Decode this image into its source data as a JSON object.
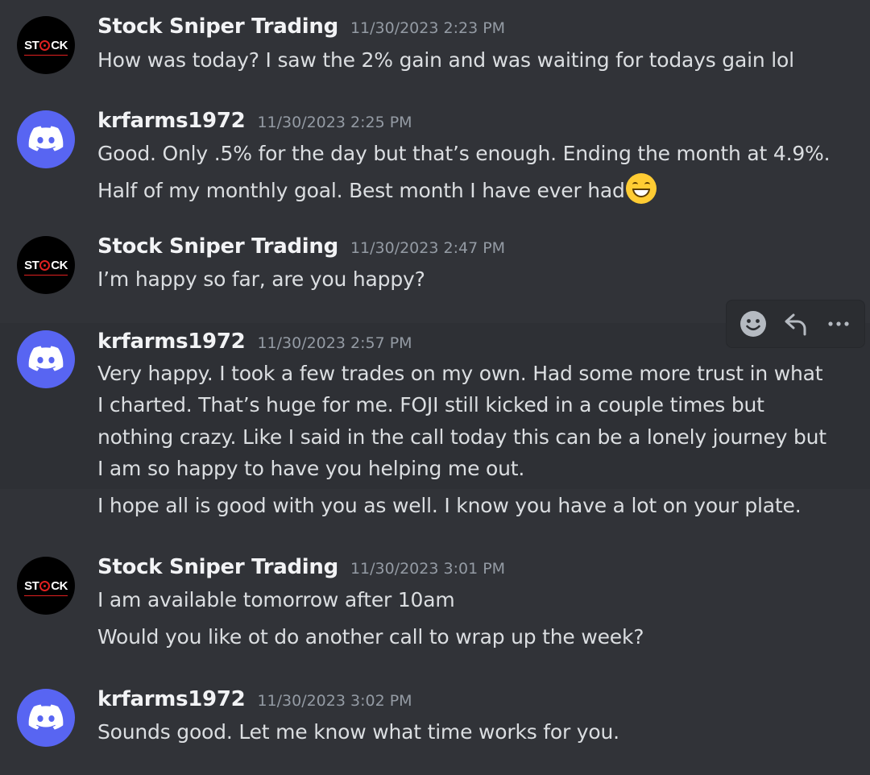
{
  "messages": [
    {
      "author": "Stock Sniper Trading",
      "timestamp": "11/30/2023 2:23 PM",
      "avatar_text": "ST  CK",
      "lines": [
        "How was today? I saw the 2% gain and was waiting for todays gain lol"
      ]
    },
    {
      "author": "krfarms1972",
      "timestamp": "11/30/2023 2:25 PM",
      "lines": [
        "Good. Only .5% for the day but that’s enough. Ending the month at 4.9%.",
        "Half of my monthly goal. Best month I have ever had"
      ],
      "emoji": "grinning-face-with-smiling-eyes"
    },
    {
      "author": "Stock Sniper Trading",
      "timestamp": "11/30/2023 2:47 PM",
      "lines": [
        "I’m happy so far, are you happy?"
      ]
    },
    {
      "author": "krfarms1972",
      "timestamp": "11/30/2023 2:57 PM",
      "lines": [
        "Very happy. I took a few trades on my own. Had some more trust in what",
        "I charted. That’s huge for me. FOJI still kicked in a couple times but",
        "nothing crazy. Like I said in the call today this can be a lonely journey but",
        "I am so happy to have you helping me out."
      ],
      "followup": "I hope all is good with you as well. I know you have a lot on your plate."
    },
    {
      "author": "Stock Sniper Trading",
      "timestamp": "11/30/2023 3:01 PM",
      "lines": [
        "I am available tomorrow after 10am"
      ],
      "followup": "Would you like ot do another call to wrap up the week?"
    },
    {
      "author": "krfarms1972",
      "timestamp": "11/30/2023 3:02 PM",
      "lines": [
        "Sounds good. Let me know what time works for you."
      ]
    }
  ],
  "toolbar": {
    "icons": [
      "add-reaction-icon",
      "reply-icon",
      "more-options-icon"
    ]
  },
  "colors": {
    "background": "#313338",
    "hover_background": "#2e3035",
    "username": "#f2f3f5",
    "timestamp": "#949ba4",
    "text": "#dbdee1",
    "discord_blurple": "#5865f2"
  }
}
